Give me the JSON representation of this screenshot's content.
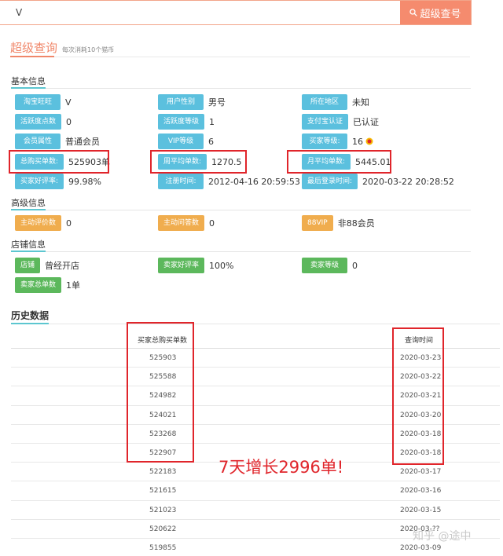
{
  "search": {
    "value": "V",
    "button_label": "超级查号"
  },
  "header": {
    "title": "超级查询",
    "subtitle": "每次消耗10个猫币"
  },
  "sections": {
    "basic": "基本信息",
    "advanced": "高级信息",
    "shop": "店铺信息",
    "history": "历史数据"
  },
  "basic_info": [
    {
      "label": "淘宝旺旺",
      "value": "V"
    },
    {
      "label": "用户性别",
      "value": "男号"
    },
    {
      "label": "所在地区",
      "value": "未知"
    },
    {
      "label": "活跃度点数",
      "value": "0"
    },
    {
      "label": "活跃度等级",
      "value": "1"
    },
    {
      "label": "支付宝认证",
      "value": "已认证"
    },
    {
      "label": "会员属性",
      "value": "普通会员"
    },
    {
      "label": "VIP等级",
      "value": "6"
    },
    {
      "label": "买家等级:",
      "value": "16"
    },
    {
      "label": "总购买单数:",
      "value": "525903单"
    },
    {
      "label": "周平均单数:",
      "value": "1270.5"
    },
    {
      "label": "月平均单数:",
      "value": "5445.01"
    },
    {
      "label": "买家好评率:",
      "value": "99.98%"
    },
    {
      "label": "注册时间:",
      "value": "2012-04-16 20:59:53"
    },
    {
      "label": "最后登录时间:",
      "value": "2020-03-22 20:28:52"
    }
  ],
  "advanced_info": [
    {
      "label": "主动评价数",
      "value": "0"
    },
    {
      "label": "主动问答数",
      "value": "0"
    },
    {
      "label": "88VIP",
      "value": "非88会员"
    }
  ],
  "shop_info": [
    {
      "label": "店铺",
      "value": "曾经开店"
    },
    {
      "label": "卖家好评率",
      "value": "100%"
    },
    {
      "label": "卖家等级",
      "value": "0"
    },
    {
      "label": "卖家总单数",
      "value": "1单"
    }
  ],
  "history": {
    "columns": [
      "买家总购买单数",
      "查询时间"
    ],
    "rows": [
      [
        "525903",
        "2020-03-23"
      ],
      [
        "525588",
        "2020-03-22"
      ],
      [
        "524982",
        "2020-03-21"
      ],
      [
        "524021",
        "2020-03-20"
      ],
      [
        "523268",
        "2020-03-18"
      ],
      [
        "522907",
        "2020-03-18"
      ],
      [
        "522183",
        "2020-03-17"
      ],
      [
        "521615",
        "2020-03-16"
      ],
      [
        "521023",
        "2020-03-15"
      ],
      [
        "520622",
        "2020-03-??"
      ],
      [
        "519855",
        "2020-03-09"
      ]
    ]
  },
  "annotation": "7天增长2996单!",
  "watermark": "知乎 @途中",
  "colors": {
    "accent": "#f0876a",
    "tag_blue": "#5bc0de",
    "tag_orange": "#f0ad4e",
    "tag_green": "#5cb85c",
    "highlight_red": "#e0252b"
  }
}
